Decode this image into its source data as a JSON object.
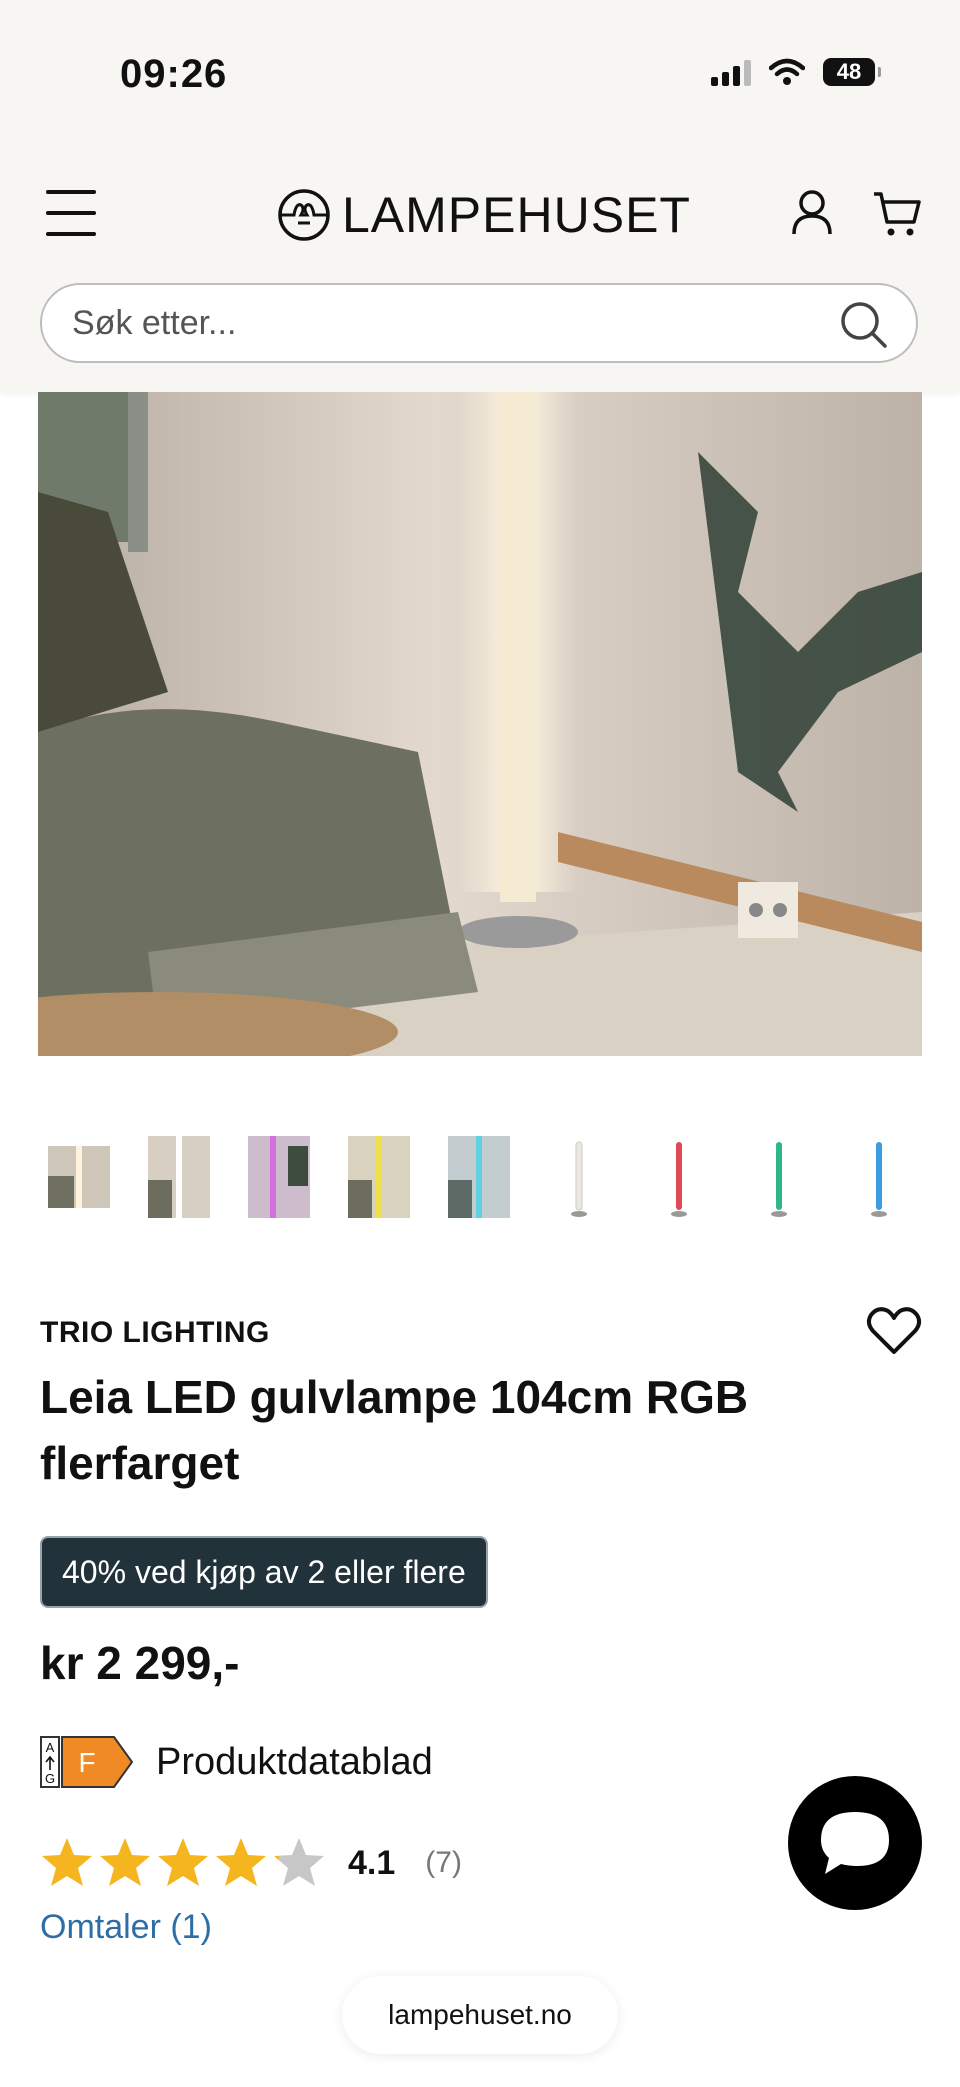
{
  "status_bar": {
    "time": "09:26",
    "battery": "48"
  },
  "header": {
    "logo": "LAMPEHUSET"
  },
  "search": {
    "placeholder": "Søk etter..."
  },
  "product": {
    "brand": "TRIO LIGHTING",
    "title": "Leia LED gulvlampe 104cm RGB flerfarget",
    "promo": "40% ved kjøp av 2 eller flere",
    "price": "kr 2 299,-",
    "energy_class": "F",
    "energy_scale_letters": [
      "A",
      "G"
    ],
    "energy_color": "#f08a24",
    "datasheet_label": "Produktdatablad",
    "rating_value": "4.1",
    "rating_stars": 4.1,
    "rating_count": "(7)",
    "reviews_link": "Omtaler (1)"
  },
  "thumbnails": [
    {
      "name": "photo-1",
      "color": "#e9e2cf"
    },
    {
      "name": "photo-2",
      "color": "#f1eee8"
    },
    {
      "name": "photo-3",
      "color": "#c86bd6"
    },
    {
      "name": "photo-4",
      "color": "#e8d84a"
    },
    {
      "name": "photo-5",
      "color": "#5bc6d6"
    },
    {
      "name": "white",
      "color": "#ece8e0"
    },
    {
      "name": "red",
      "color": "#e04a58"
    },
    {
      "name": "green",
      "color": "#2fb58a"
    },
    {
      "name": "blue",
      "color": "#3b9ce0"
    }
  ],
  "browser": {
    "domain": "lampehuset.no"
  },
  "colors": {
    "star": "#f5b51e",
    "star_empty": "#c7c7c7",
    "promo_bg": "#22323a",
    "link": "#2e6ea6"
  }
}
